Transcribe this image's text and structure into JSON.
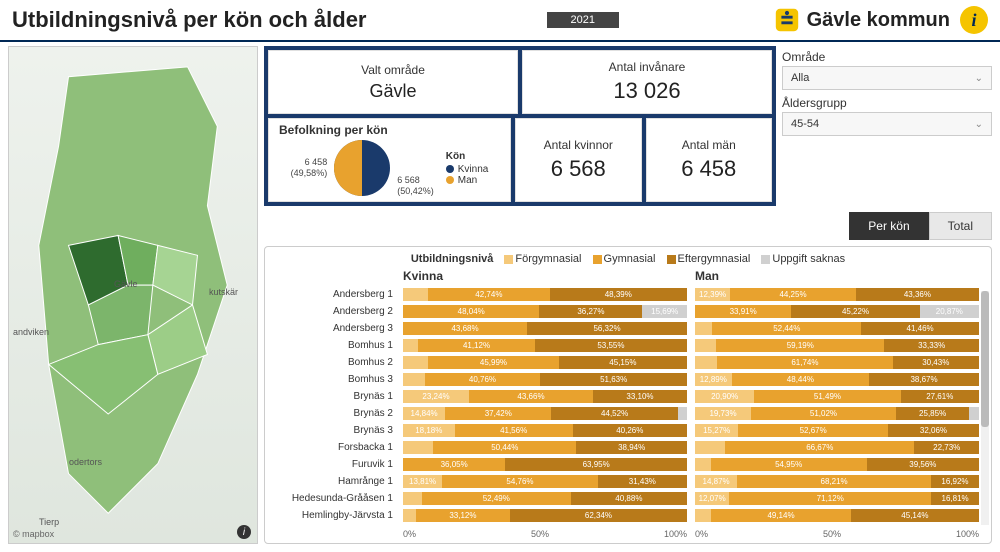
{
  "header": {
    "title": "Utbildningsnivå per kön och ålder",
    "year": "2021",
    "brand": "Gävle kommun"
  },
  "filters": {
    "area_label": "Område",
    "area_value": "Alla",
    "age_label": "Åldersgrupp",
    "age_value": "45-54"
  },
  "cards": {
    "valt_label": "Valt område",
    "valt_value": "Gävle",
    "invanare_label": "Antal invånare",
    "invanare_value": "13 026",
    "kvinnor_label": "Antal kvinnor",
    "kvinnor_value": "6 568",
    "man_label": "Antal män",
    "man_value": "6 458"
  },
  "pie": {
    "title": "Befolkning per kön",
    "legend_title": "Kön",
    "legend_kvinna": "Kvinna",
    "legend_man": "Man",
    "kvinna_value": "6 568",
    "kvinna_pct": "(50,42%)",
    "man_value": "6 458",
    "man_pct": "(49,58%)"
  },
  "tabs": {
    "per_kon": "Per kön",
    "total": "Total"
  },
  "chart_legend": {
    "title": "Utbildningsnivå",
    "c1": "Förgymnasial",
    "c2": "Gymnasial",
    "c3": "Eftergymnasial",
    "c4": "Uppgift saknas"
  },
  "chart_headers": {
    "kvinna": "Kvinna",
    "man": "Man"
  },
  "axis": {
    "p0": "0%",
    "p50": "50%",
    "p100": "100%"
  },
  "map": {
    "attribution": "© mapbox",
    "center_label": "Gävle"
  },
  "colors": {
    "navy": "#1a3a6b",
    "gold": "#e8a22e",
    "gold_light": "#f5c97a",
    "brown": "#b87a1a",
    "grey": "#d0d0d0"
  },
  "chart_data": {
    "type": "bar",
    "stacked": true,
    "orientation": "horizontal",
    "xlabel": "",
    "ylabel": "",
    "xlim_pct": [
      0,
      100
    ],
    "series_names": [
      "Förgymnasial",
      "Gymnasial",
      "Eftergymnasial",
      "Uppgift saknas"
    ],
    "panels": [
      "Kvinna",
      "Man"
    ],
    "categories": [
      "Andersberg 1",
      "Andersberg 2",
      "Andersberg 3",
      "Bomhus 1",
      "Bomhus 2",
      "Bomhus 3",
      "Brynäs 1",
      "Brynäs 2",
      "Brynäs 3",
      "Forsbacka 1",
      "Furuvik 1",
      "Hamrånge 1",
      "Hedesunda-Grååsen 1",
      "Hemlingby-Järvsta 1"
    ],
    "kvinna": [
      [
        8.87,
        42.74,
        48.39,
        0.0
      ],
      [
        0.0,
        48.04,
        36.27,
        15.69
      ],
      [
        0.0,
        43.68,
        56.32,
        0.0
      ],
      [
        5.33,
        41.12,
        53.55,
        0.0
      ],
      [
        8.86,
        45.99,
        45.15,
        0.0
      ],
      [
        7.61,
        40.76,
        51.63,
        0.0
      ],
      [
        23.24,
        43.66,
        33.1,
        0.0
      ],
      [
        14.84,
        37.42,
        44.52,
        3.22
      ],
      [
        18.18,
        41.56,
        40.26,
        0.0
      ],
      [
        10.62,
        50.44,
        38.94,
        0.0
      ],
      [
        0.0,
        36.05,
        63.95,
        0.0
      ],
      [
        13.81,
        54.76,
        31.43,
        0.0
      ],
      [
        6.61,
        52.49,
        40.88,
        0.02
      ],
      [
        4.54,
        33.12,
        62.34,
        0.0
      ]
    ],
    "man": [
      [
        12.39,
        44.25,
        43.36,
        0.0
      ],
      [
        0.0,
        33.91,
        45.22,
        20.87
      ],
      [
        6.1,
        52.44,
        41.46,
        0.0
      ],
      [
        7.48,
        59.19,
        33.33,
        0.0
      ],
      [
        7.83,
        61.74,
        30.43,
        0.0
      ],
      [
        12.89,
        48.44,
        38.67,
        0.0
      ],
      [
        20.9,
        51.49,
        27.61,
        0.0
      ],
      [
        19.73,
        51.02,
        25.85,
        3.4
      ],
      [
        15.27,
        52.67,
        32.06,
        0.0
      ],
      [
        10.6,
        66.67,
        22.73,
        0.0
      ],
      [
        5.5,
        54.95,
        39.56,
        0.0
      ],
      [
        14.87,
        68.21,
        16.92,
        0.0
      ],
      [
        12.07,
        71.12,
        16.81,
        0.0
      ],
      [
        5.72,
        49.14,
        45.14,
        0.0
      ]
    ],
    "labeled_kvinna": [
      [
        null,
        "42,74%",
        "48,39%",
        null
      ],
      [
        "48,04%",
        "36,27%",
        "15,69%",
        null
      ],
      [
        "43,68%",
        "56,32%",
        null,
        null
      ],
      [
        "41,12%",
        "53,55%",
        null,
        null
      ],
      [
        "45,99%",
        "45,15%",
        null,
        null
      ],
      [
        "40,76%",
        "51,63%",
        null,
        null
      ],
      [
        "23,24%",
        "43,66%",
        "33,10%",
        null
      ],
      [
        "14,84%",
        "37,42%",
        "44,52%",
        null
      ],
      [
        "18,18%",
        "41,56%",
        "40,26%",
        null
      ],
      [
        "50,44%",
        "38,94%",
        null,
        null
      ],
      [
        "36,05%",
        "63,95%",
        null,
        null
      ],
      [
        "13,81%",
        "54,76%",
        "31,43%",
        null
      ],
      [
        "52,49%",
        "40,88%",
        null,
        null
      ],
      [
        "33,12%",
        "62,34%",
        null,
        null
      ]
    ],
    "labeled_man": [
      [
        "12,39%",
        "44,25%",
        "43,36%",
        null
      ],
      [
        "33,91%",
        "45,22%",
        "20,87%",
        null
      ],
      [
        "52,44%",
        "41,46%",
        null,
        null
      ],
      [
        "59,19%",
        "33,33%",
        null,
        null
      ],
      [
        "61,74%",
        "30,43%",
        null,
        null
      ],
      [
        "12,89%",
        "48,44%",
        "38,67%",
        null
      ],
      [
        "20,90%",
        "51,49%",
        "27,61%",
        null
      ],
      [
        "19,73%",
        "51,02%",
        "25,85%",
        null
      ],
      [
        "15,27%",
        "52,67%",
        "32,06%",
        null
      ],
      [
        "66,67%",
        "22,73%",
        null,
        null
      ],
      [
        "54,95%",
        "39,56%",
        null,
        null
      ],
      [
        "14,87%",
        "68,21%",
        "16,92%",
        null
      ],
      [
        "12,07%",
        "71,12%",
        "16,81%",
        null
      ],
      [
        "49,14%",
        "45,14%",
        null,
        null
      ]
    ]
  }
}
